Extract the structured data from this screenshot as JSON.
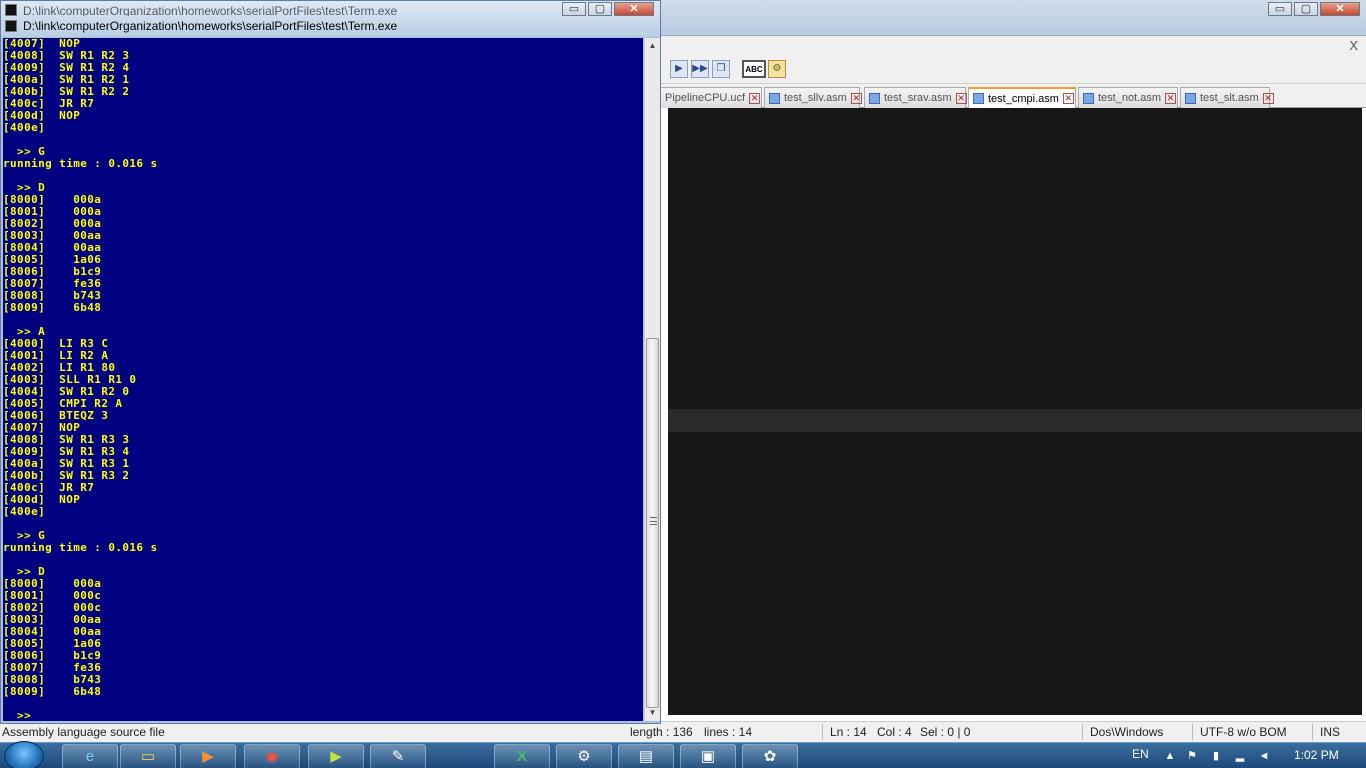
{
  "console": {
    "title_back": "D:\\link\\computerOrganization\\homeworks\\serialPortFiles\\test\\Term.exe",
    "title": "D:\\link\\computerOrganization\\homeworks\\serialPortFiles\\test\\Term.exe",
    "buttons": {
      "minimize": "▭",
      "maximize": "▢",
      "close": "✕"
    },
    "lines": [
      "[4007]  NOP",
      "[4008]  SW R1 R2 3",
      "[4009]  SW R1 R2 4",
      "[400a]  SW R1 R2 1",
      "[400b]  SW R1 R2 2",
      "[400c]  JR R7",
      "[400d]  NOP",
      "[400e]",
      "",
      "  >> G",
      "running time : 0.016 s",
      "",
      "  >> D",
      "[8000]    000a",
      "[8001]    000a",
      "[8002]    000a",
      "[8003]    00aa",
      "[8004]    00aa",
      "[8005]    1a06",
      "[8006]    b1c9",
      "[8007]    fe36",
      "[8008]    b743",
      "[8009]    6b48",
      "",
      "  >> A",
      "[4000]  LI R3 C",
      "[4001]  LI R2 A",
      "[4002]  LI R1 80",
      "[4003]  SLL R1 R1 0",
      "[4004]  SW R1 R2 0",
      "[4005]  CMPI R2 A",
      "[4006]  BTEQZ 3",
      "[4007]  NOP",
      "[4008]  SW R1 R3 3",
      "[4009]  SW R1 R3 4",
      "[400a]  SW R1 R3 1",
      "[400b]  SW R1 R3 2",
      "[400c]  JR R7",
      "[400d]  NOP",
      "[400e]",
      "",
      "  >> G",
      "running time : 0.016 s",
      "",
      "  >> D",
      "[8000]    000a",
      "[8001]    000c",
      "[8002]    000c",
      "[8003]    00aa",
      "[8004]    00aa",
      "[8005]    1a06",
      "[8006]    b1c9",
      "[8007]    fe36",
      "[8008]    b743",
      "[8009]    6b48",
      "",
      "  >>"
    ],
    "colors": {
      "background": "#000080",
      "text": "#ffff00"
    }
  },
  "editor": {
    "buttons": {
      "minimize": "▭",
      "maximize": "▢",
      "close": "✕"
    },
    "menu_close": "X",
    "tabs": [
      {
        "label": "PipelineCPU.ucf",
        "active": false
      },
      {
        "label": "test_sllv.asm",
        "active": false
      },
      {
        "label": "test_srav.asm",
        "active": false
      },
      {
        "label": "test_cmpi.asm",
        "active": true
      },
      {
        "label": "test_not.asm",
        "active": false
      },
      {
        "label": "test_slt.asm",
        "active": false
      }
    ],
    "toolbar_icons": [
      "play-icon",
      "play-all-icon",
      "copy-icon",
      "spellcheck-icon",
      "settings-icon"
    ],
    "spell_label": "ABC",
    "statusbar": {
      "file_type": "Assembly language source file",
      "length": "length : 136",
      "lines": "lines : 14",
      "ln": "Ln : 14",
      "col": "Col : 4",
      "sel": "Sel : 0 | 0",
      "eol": "Dos\\Windows",
      "encoding": "UTF-8 w/o BOM",
      "mode": "INS"
    },
    "colors": {
      "background": "#171717",
      "current_line": "#2a2a2a",
      "active_tab_accent": "#f0a030"
    }
  },
  "taskbar": {
    "items": [
      "internet-explorer",
      "file-explorer",
      "media-player",
      "chrome",
      "notepad-plus",
      "notepad",
      "excel",
      "network-tool",
      "window-app",
      "remote-desktop",
      "paint"
    ],
    "language": "EN",
    "time": "1:02 PM"
  }
}
